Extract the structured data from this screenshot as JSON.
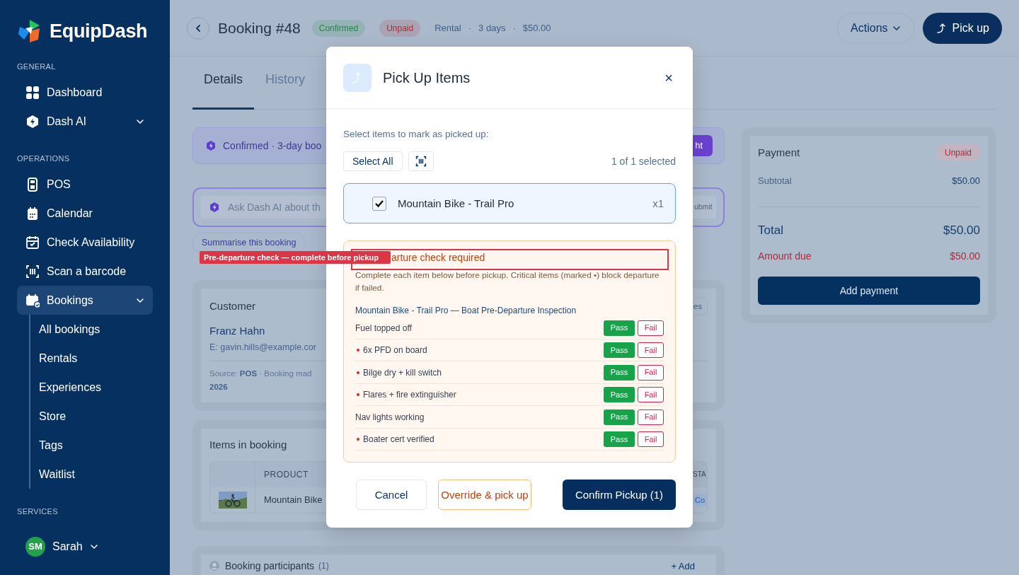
{
  "sidebar": {
    "brand": "EquipDash",
    "sections": [
      {
        "heading": "GENERAL",
        "items": [
          {
            "label": "Dashboard",
            "kind": "link",
            "selected": false
          },
          {
            "label": "Dash AI",
            "kind": "group",
            "selected": false
          }
        ]
      },
      {
        "heading": "OPERATIONS",
        "items": [
          {
            "label": "POS",
            "kind": "link",
            "selected": false
          },
          {
            "label": "Calendar",
            "kind": "link",
            "selected": false
          },
          {
            "label": "Check Availability",
            "kind": "link",
            "selected": false
          },
          {
            "label": "Scan a barcode",
            "kind": "link",
            "selected": false
          },
          {
            "label": "Bookings",
            "kind": "group",
            "selected": true,
            "children": [
              {
                "label": "All bookings"
              },
              {
                "label": "Rentals"
              },
              {
                "label": "Experiences"
              },
              {
                "label": "Store"
              },
              {
                "label": "Tags"
              },
              {
                "label": "Waitlist"
              }
            ]
          }
        ]
      },
      {
        "heading": "SERVICES"
      }
    ],
    "user": {
      "initials": "SM",
      "name": "Sarah"
    }
  },
  "header": {
    "title": "Booking #48",
    "badges": [
      {
        "label": "Confirmed",
        "color": "#1f8a43"
      },
      {
        "label": "Unpaid",
        "color": "#b02a37"
      }
    ],
    "meta": [
      "Rental",
      "·",
      "3 days",
      "·",
      "$50.00"
    ],
    "actions": [
      {
        "kind": "menu",
        "label": "Actions"
      },
      {
        "kind": "primary",
        "label": "Pick up"
      }
    ]
  },
  "tabs": [
    {
      "label": "Details",
      "selected": true
    },
    {
      "label": "History",
      "selected": false
    }
  ],
  "summary_alert": {
    "text": "Confirmed · 3-day boo",
    "button_fragment": "ht"
  },
  "ask_ai": {
    "placeholder": "Ask Dash AI about th",
    "submit_fragment": "ubmit"
  },
  "suggestions": [
    "Summarise this booking"
  ],
  "customer_card": {
    "title": "Customer",
    "button_fragment": "es",
    "name": "Franz Hahn",
    "email": "E: gavin.hills@example.cor",
    "source_line": "Source: **POS**  ·  Booking mad",
    "source_line_2": "2026"
  },
  "items_card": {
    "title": "Items in booking",
    "columns": [
      "PRODUCT",
      "STA"
    ],
    "rows": [
      {
        "product": "Mountain Bike",
        "status": "Co"
      }
    ]
  },
  "participants": {
    "title": "Booking participants",
    "count": "(1)",
    "add": "+ Add"
  },
  "payment": {
    "title": "Payment",
    "status": "Unpaid",
    "rows": [
      {
        "kind": "subtotal",
        "label": "Subtotal",
        "value": "$50.00"
      },
      {
        "kind": "total",
        "label": "Total",
        "value": "$50.00"
      },
      {
        "kind": "due",
        "label": "Amount due",
        "value": "$50.00"
      }
    ],
    "button": "Add payment"
  },
  "annotation": {
    "label": "Pre-departure check — complete before pickup"
  },
  "modal": {
    "title": "Pick Up Items",
    "close": "×",
    "prompt": "Select items to mark as picked up:",
    "select_all": "Select All",
    "count": "1 of 1 selected",
    "items": [
      {
        "name": "Mountain Bike - Trail Pro",
        "qty": "x1",
        "checked": true
      }
    ],
    "check": {
      "heading": "arture check required",
      "description": "Complete each item below before pickup. Critical items (marked •) block departure if failed.",
      "section": "Mountain Bike - Trail Pro — Boat Pre-Departure Inspection",
      "items": [
        {
          "label": "Fuel topped off",
          "critical": false,
          "pass": "Pass",
          "fail": "Fail"
        },
        {
          "label": "6x PFD on board",
          "critical": true,
          "pass": "Pass",
          "fail": "Fail"
        },
        {
          "label": "Bilge dry + kill switch",
          "critical": true,
          "pass": "Pass",
          "fail": "Fail"
        },
        {
          "label": "Flares + fire extinguisher",
          "critical": true,
          "pass": "Pass",
          "fail": "Fail"
        },
        {
          "label": "Nav lights working",
          "critical": false,
          "pass": "Pass",
          "fail": "Fail"
        },
        {
          "label": "Boater cert verified",
          "critical": true,
          "pass": "Pass",
          "fail": "Fail"
        }
      ]
    },
    "buttons": [
      {
        "kind": "cancel",
        "label": "Cancel"
      },
      {
        "kind": "override",
        "label": "Override & pick up"
      },
      {
        "kind": "confirm",
        "label": "Confirm Pickup (1)"
      }
    ]
  }
}
